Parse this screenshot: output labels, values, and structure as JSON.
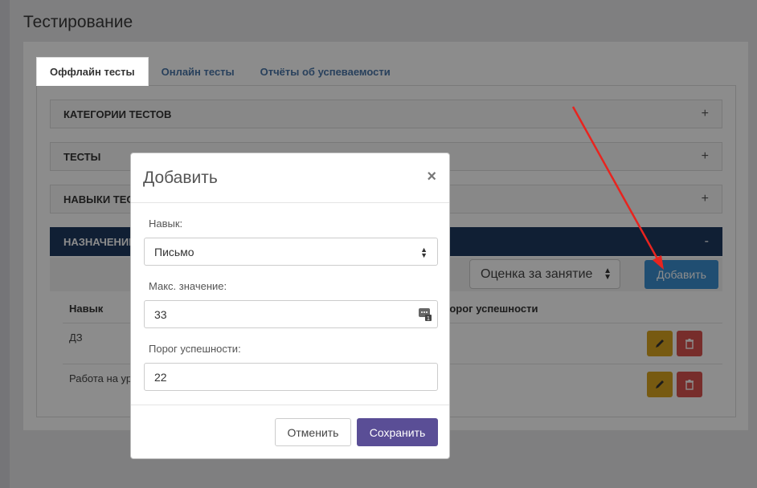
{
  "page": {
    "title": "Тестирование"
  },
  "tabs": [
    {
      "label": "Оффлайн тесты",
      "active": true
    },
    {
      "label": "Онлайн тесты",
      "active": false
    },
    {
      "label": "Отчёты об успеваемости",
      "active": false
    }
  ],
  "accordion": [
    {
      "label": "КАТЕГОРИИ ТЕСТОВ",
      "sign": "+"
    },
    {
      "label": "ТЕСТЫ",
      "sign": "+"
    },
    {
      "label": "НАВЫКИ ТЕСТОВ",
      "sign": "+"
    },
    {
      "label": "НАЗНАЧЕНИЕ",
      "sign": "-"
    }
  ],
  "toolbar": {
    "select_value": "Оценка за занятие",
    "add_label": "Добавить"
  },
  "table": {
    "headers": [
      "Навык",
      "Порог успешности"
    ],
    "rows": [
      {
        "skill": "ДЗ"
      },
      {
        "skill": "Работа на уроке"
      }
    ]
  },
  "modal": {
    "title": "Добавить",
    "close": "×",
    "skill_label": "Навык:",
    "skill_value": "Письмо",
    "max_label": "Макс. значение:",
    "max_value": "33",
    "threshold_label": "Порог успешности:",
    "threshold_value": "22",
    "cancel_label": "Отменить",
    "save_label": "Сохранить"
  },
  "colors": {
    "accent": "#5a4e96",
    "add_button": "#3b8fd0",
    "accordion_dark": "#1e3a5f",
    "annotation_arrow": "#e8241f"
  }
}
